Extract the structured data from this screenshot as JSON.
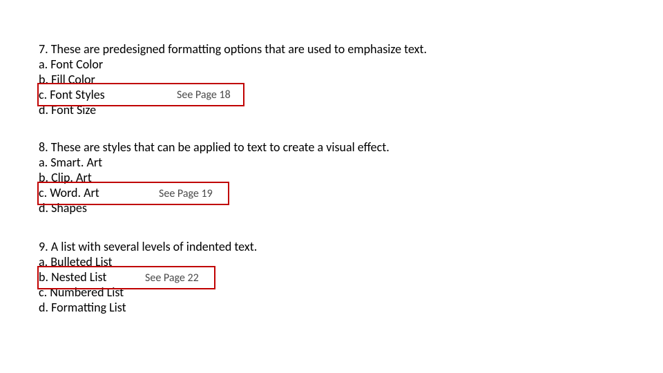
{
  "questions": [
    {
      "number": "7",
      "prompt": "These are predesigned formatting options that are used to emphasize text.",
      "options": {
        "a": "Font Color",
        "b": "Fill Color",
        "c": "Font Styles",
        "d": "Font Size"
      },
      "hint": "See Page 18"
    },
    {
      "number": "8",
      "prompt": "These are styles that can be applied to text to create a visual effect.",
      "options": {
        "a": "Smart. Art",
        "b": "Clip. Art",
        "c": "Word. Art",
        "d": "Shapes"
      },
      "hint": "See Page 19"
    },
    {
      "number": "9",
      "prompt": "A list with several levels of indented text.",
      "options": {
        "a": "Bulleted List",
        "b": "Nested List",
        "c": "Numbered List",
        "d": "Formatting List"
      },
      "hint": "See Page 22"
    }
  ]
}
